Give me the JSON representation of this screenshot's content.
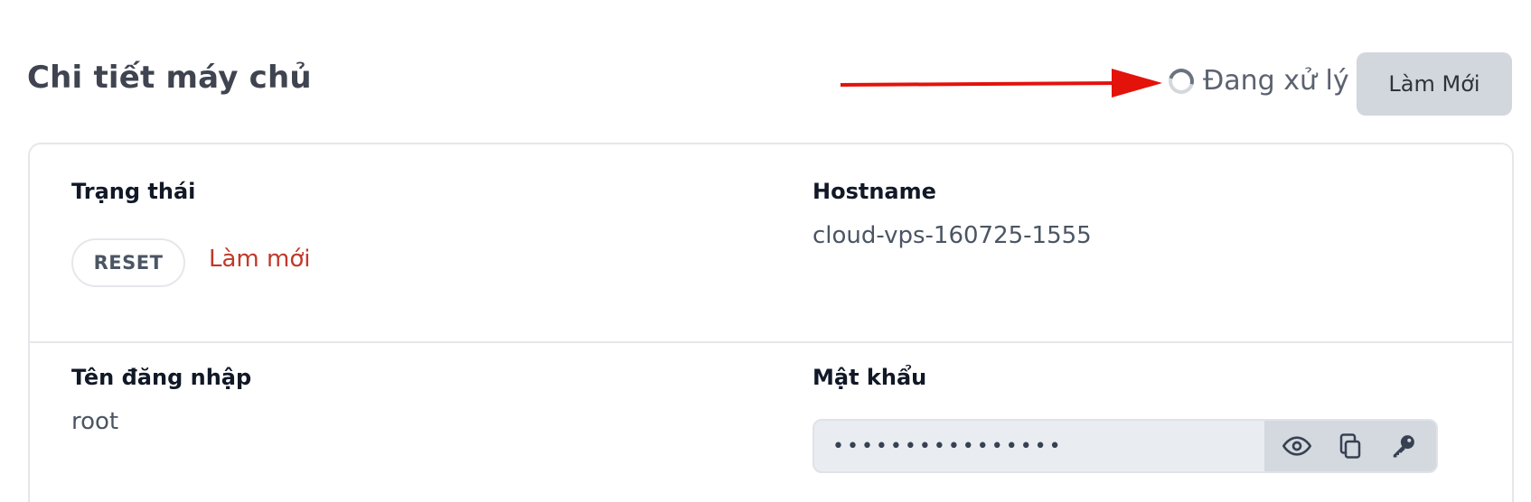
{
  "header": {
    "title": "Chi tiết máy chủ",
    "processing_text": "Đang xử lý",
    "refresh_button_label": "Làm Mới"
  },
  "details": {
    "status": {
      "label": "Trạng thái",
      "badge": "RESET",
      "refresh_link": "Làm mới"
    },
    "hostname": {
      "label": "Hostname",
      "value": "cloud-vps-160725-1555"
    },
    "username": {
      "label": "Tên đăng nhập",
      "value": "root"
    },
    "password": {
      "label": "Mật khẩu",
      "masked_value": "••••••••••••••••"
    }
  },
  "icons": [
    "spinner-icon",
    "eye-icon",
    "copy-icon",
    "key-icon"
  ],
  "colors": {
    "annotation_arrow": "#e3120b",
    "link": "#c0392b",
    "button_bg": "#d2d6dd"
  }
}
